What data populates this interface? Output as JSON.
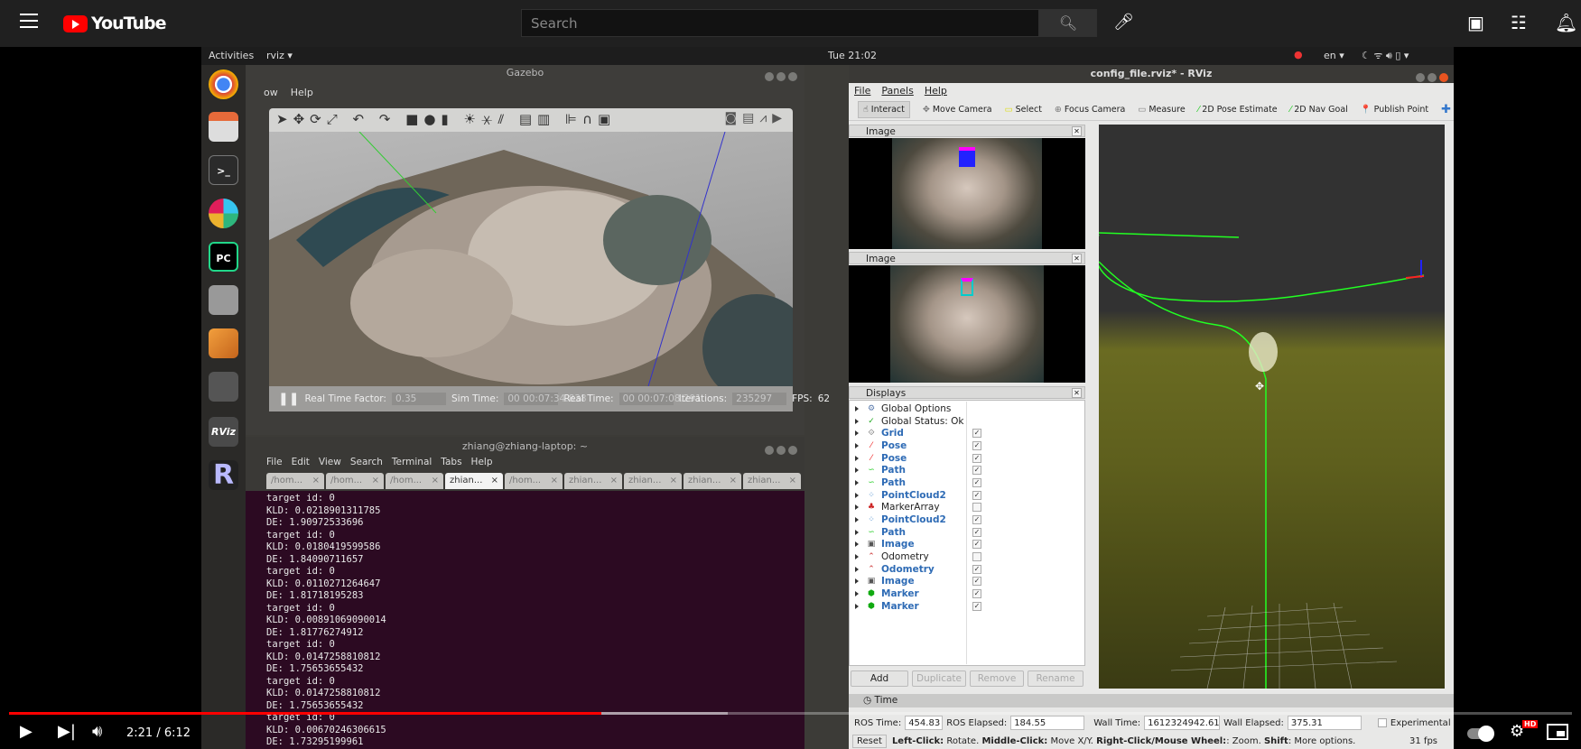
{
  "youtube": {
    "logo": "YouTube",
    "search_placeholder": "Search",
    "time_current": "2:21",
    "time_total": "6:12",
    "time_display": "2:21 / 6:12",
    "progress_fraction": 0.379,
    "buffered_fraction": 0.46,
    "hd_badge": "HD",
    "accent": "#ff0000",
    "icons": [
      "menu-icon",
      "search-icon",
      "mic-icon",
      "create-video-icon",
      "apps-icon",
      "bell-icon",
      "play-icon",
      "next-icon",
      "volume-icon",
      "autoplay-toggle",
      "settings-icon",
      "miniplayer-icon"
    ]
  },
  "ubuntu": {
    "activities": "Activities",
    "app_menu": "rviz ▾",
    "clock": "Tue 21:02",
    "lang": "en ▾",
    "dock": [
      {
        "name": "chrome"
      },
      {
        "name": "files"
      },
      {
        "name": "terminal",
        "label": ">_"
      },
      {
        "name": "slack"
      },
      {
        "name": "pycharm",
        "label": "PC"
      },
      {
        "name": "camera"
      },
      {
        "name": "blender"
      },
      {
        "name": "app"
      },
      {
        "name": "rviz",
        "label": "RViz"
      },
      {
        "name": "r",
        "label": "R"
      }
    ]
  },
  "gazebo": {
    "title": "Gazebo",
    "menu": [
      "ow",
      "Help"
    ],
    "status": {
      "rtf_label": "Real Time Factor:",
      "rtf": "0.35",
      "sim_label": "Sim Time:",
      "sim": "00 00:07:34.838",
      "real_label": "Real Time:",
      "real": "00 00:07:08.291",
      "iter_label": "Iterations:",
      "iter": "235297",
      "fps_label": "FPS:",
      "fps": "62"
    }
  },
  "terminal": {
    "title": "zhiang@zhiang-laptop: ~",
    "menu": [
      "File",
      "Edit",
      "View",
      "Search",
      "Terminal",
      "Tabs",
      "Help"
    ],
    "tabs": [
      {
        "label": "/hom...",
        "active": false
      },
      {
        "label": "/hom...",
        "active": false
      },
      {
        "label": "/hom...",
        "active": false
      },
      {
        "label": "zhian...",
        "active": true
      },
      {
        "label": "/hom...",
        "active": false
      },
      {
        "label": "zhian...",
        "active": false
      },
      {
        "label": "zhian...",
        "active": false
      },
      {
        "label": "zhian...",
        "active": false
      },
      {
        "label": "zhian...",
        "active": false
      }
    ],
    "lines": [
      "target id: 0",
      "KLD: 0.0218901311785",
      "DE: 1.90972533696",
      "target id: 0",
      "KLD: 0.0180419599586",
      "DE: 1.84090711657",
      "target id: 0",
      "KLD: 0.0110271264647",
      "DE: 1.81718195283",
      "target id: 0",
      "KLD: 0.00891069090014",
      "DE: 1.81776274912",
      "target id: 0",
      "KLD: 0.0147258810812",
      "DE: 1.75653655432",
      "target id: 0",
      "KLD: 0.0147258810812",
      "DE: 1.75653655432",
      "target id: 0",
      "KLD: 0.00670246306615",
      "DE: 1.73295199961"
    ]
  },
  "rviz": {
    "title": "config_file.rviz* - RViz",
    "menu": [
      "File",
      "Panels",
      "Help"
    ],
    "toolbar": [
      "Interact",
      "Move Camera",
      "Select",
      "Focus Camera",
      "Measure",
      "2D Pose Estimate",
      "2D Nav Goal",
      "Publish Point"
    ],
    "image_panel_title": "Image",
    "displays_title": "Displays",
    "displays": [
      {
        "label": "Global Options",
        "icon": "gear-icon",
        "checkable": false,
        "enabled": false
      },
      {
        "label": "Global Status: Ok",
        "icon": "check-icon",
        "checkable": false,
        "enabled": false
      },
      {
        "label": "Grid",
        "icon": "grid-icon",
        "checked": true,
        "enabled": true
      },
      {
        "label": "Pose",
        "icon": "pose-icon",
        "checked": true,
        "enabled": true
      },
      {
        "label": "Pose",
        "icon": "pose-icon",
        "checked": true,
        "enabled": true
      },
      {
        "label": "Path",
        "icon": "path-icon",
        "checked": true,
        "enabled": true
      },
      {
        "label": "Path",
        "icon": "path-icon",
        "checked": true,
        "enabled": true
      },
      {
        "label": "PointCloud2",
        "icon": "pointcloud-icon",
        "checked": true,
        "enabled": true
      },
      {
        "label": "MarkerArray",
        "icon": "marker-array-icon",
        "checked": false,
        "enabled": false
      },
      {
        "label": "PointCloud2",
        "icon": "pointcloud-icon",
        "checked": true,
        "enabled": true
      },
      {
        "label": "Path",
        "icon": "path-icon",
        "checked": true,
        "enabled": true
      },
      {
        "label": "Image",
        "icon": "image-icon",
        "checked": true,
        "enabled": true
      },
      {
        "label": "Odometry",
        "icon": "odometry-icon",
        "checked": false,
        "enabled": false
      },
      {
        "label": "Odometry",
        "icon": "odometry-icon",
        "checked": true,
        "enabled": true
      },
      {
        "label": "Image",
        "icon": "image-icon",
        "checked": true,
        "enabled": true
      },
      {
        "label": "Marker",
        "icon": "marker-icon",
        "checked": true,
        "enabled": true
      },
      {
        "label": "Marker",
        "icon": "marker-icon",
        "checked": true,
        "enabled": true
      }
    ],
    "buttons": {
      "add": "Add",
      "duplicate": "Duplicate",
      "remove": "Remove",
      "rename": "Rename"
    },
    "time": {
      "title": "Time",
      "ros_time_label": "ROS Time:",
      "ros_time": "454.83",
      "ros_elapsed_label": "ROS Elapsed:",
      "ros_elapsed": "184.55",
      "wall_time_label": "Wall Time:",
      "wall_time": "1612324942.61",
      "wall_elapsed_label": "Wall Elapsed:",
      "wall_elapsed": "375.31",
      "experimental": "Experimental"
    },
    "status": {
      "reset": "Reset",
      "help_b1": "Left-Click:",
      "help_t1": " Rotate.",
      "help_b2": "Middle-Click:",
      "help_t2": " Move X/Y.",
      "help_b3": "Right-Click/Mouse Wheel:",
      "help_t3": ": Zoom.",
      "help_b4": "Shift",
      "help_t4": ": More options.",
      "fps": "31 fps"
    }
  }
}
